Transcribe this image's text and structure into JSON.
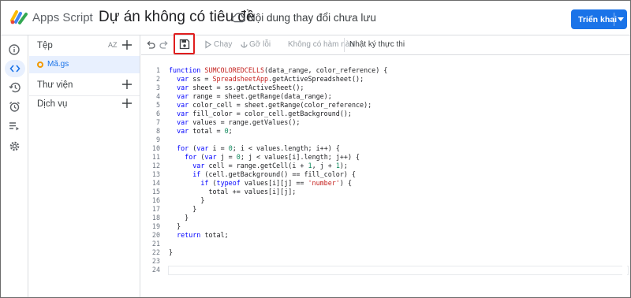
{
  "header": {
    "app_name": "Apps Script",
    "project_title": "Dự án không có tiêu đề",
    "save_status": "Nội dung thay đổi chưa lưu",
    "deploy_label": "Triển khai"
  },
  "rail": {
    "items": [
      {
        "icon": "info-icon"
      },
      {
        "icon": "code-icon",
        "active": true
      },
      {
        "icon": "history-icon"
      },
      {
        "icon": "alarm-icon"
      },
      {
        "icon": "executions-icon"
      },
      {
        "icon": "settings-icon"
      }
    ]
  },
  "files": {
    "header_label": "Tệp",
    "sort_label": "AZ",
    "file_name": "Mã.gs",
    "libraries_label": "Thư viện",
    "services_label": "Dịch vụ"
  },
  "toolbar": {
    "run_label": "Chạy",
    "debug_label": "Gỡ lỗi",
    "function_label": "Không có hàm nào",
    "log_label": "Nhật ký thực thi"
  },
  "editor": {
    "line_numbers": [
      "1",
      "2",
      "3",
      "4",
      "5",
      "6",
      "7",
      "8",
      "9",
      "10",
      "11",
      "12",
      "13",
      "14",
      "15",
      "16",
      "17",
      "18",
      "19",
      "20",
      "21",
      "22",
      "23",
      "24"
    ],
    "lines": [
      "function SUMCOLOREDCELLS(data_range, color_reference) {",
      "  var ss = SpreadsheetApp.getActiveSpreadsheet();",
      "  var sheet = ss.getActiveSheet();",
      "  var range = sheet.getRange(data_range);",
      "  var color_cell = sheet.getRange(color_reference);",
      "  var fill_color = color_cell.getBackground();",
      "  var values = range.getValues();",
      "  var total = 0;",
      "",
      "  for (var i = 0; i < values.length; i++) {",
      "    for (var j = 0; j < values[i].length; j++) {",
      "      var cell = range.getCell(i + 1, j + 1);",
      "      if (cell.getBackground() == fill_color) {",
      "        if (typeof values[i][j] == 'number') {",
      "          total += values[i][j];",
      "        }",
      "      }",
      "    }",
      "  }",
      "  return total;",
      "",
      "}",
      "",
      ""
    ]
  },
  "colors": {
    "accent": "#1a73e8",
    "highlight_box": "#e01e1e",
    "keyword": "#0000ff",
    "function_name": "#c5221f",
    "string": "#c5221f",
    "number": "#098658"
  }
}
